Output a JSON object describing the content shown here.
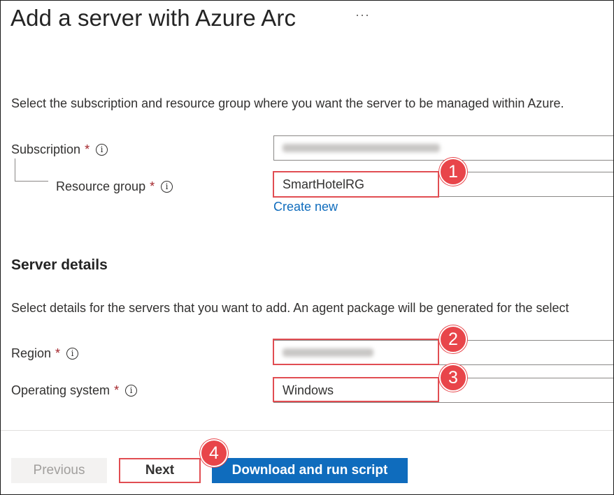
{
  "header": {
    "title": "Add a server with Azure Arc",
    "more_label": "···"
  },
  "project": {
    "description": "Select the subscription and resource group where you want the server to be managed within Azure.",
    "subscription": {
      "label": "Subscription",
      "required_mark": "*",
      "info": "i"
    },
    "resource_group": {
      "label": "Resource group",
      "required_mark": "*",
      "info": "i",
      "value": "SmartHotelRG"
    },
    "create_new_label": "Create new"
  },
  "server_details": {
    "heading": "Server details",
    "description": "Select details for the servers that you want to add. An agent package will be generated for the select",
    "region": {
      "label": "Region",
      "required_mark": "*",
      "info": "i"
    },
    "operating_system": {
      "label": "Operating system",
      "required_mark": "*",
      "info": "i",
      "value": "Windows"
    }
  },
  "annotations": [
    "1",
    "2",
    "3",
    "4"
  ],
  "footer": {
    "previous_label": "Previous",
    "next_label": "Next",
    "download_label": "Download and run script"
  },
  "colors": {
    "accent": "#0f6cbd",
    "highlight": "#e14d52",
    "required": "#a4262c"
  }
}
